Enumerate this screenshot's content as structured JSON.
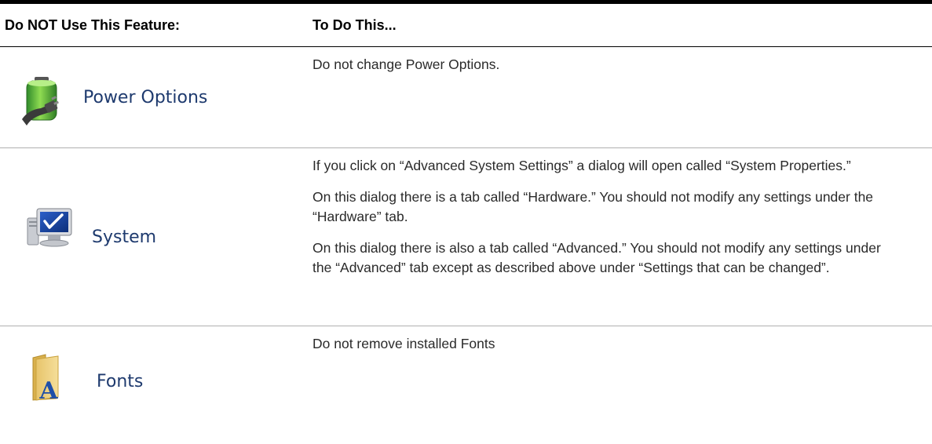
{
  "table": {
    "header": {
      "col1": "Do NOT Use This Feature:",
      "col2": "To Do This..."
    },
    "rows": [
      {
        "feature": "Power Options",
        "icon": "power-options-icon",
        "paragraphs": [
          "Do not change Power Options."
        ]
      },
      {
        "feature": "System",
        "icon": "system-icon",
        "paragraphs": [
          "If you click on “Advanced System Settings” a dialog will open called “System Properties.”",
          "On this dialog there is a tab called “Hardware.” You should not modify any settings under the “Hardware” tab.",
          "On this dialog there is also a tab called “Advanced.” You should not modify any settings under the “Advanced” tab except as described above under “Settings that can be changed”."
        ]
      },
      {
        "feature": "Fonts",
        "icon": "fonts-folder-icon",
        "paragraphs": [
          "Do not remove installed Fonts"
        ]
      }
    ]
  },
  "colors": {
    "rule": "#000000",
    "feature_text": "#1e3a6e",
    "body_text": "#2a2a2a",
    "row_divider": "#b0b0b0"
  }
}
